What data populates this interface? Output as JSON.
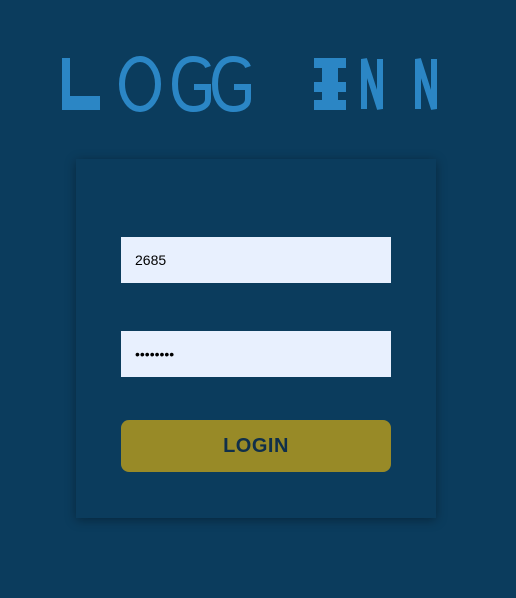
{
  "brand": {
    "logo_text": "LOGG INN",
    "logo_color": "#2b86c5"
  },
  "form": {
    "username_value": "2685",
    "password_value": "12345678",
    "login_label": "LOGIN"
  },
  "colors": {
    "background": "#0b3c5d",
    "field_background": "#e8f0fe",
    "button_background": "#988a27",
    "button_text": "#102f4a"
  }
}
